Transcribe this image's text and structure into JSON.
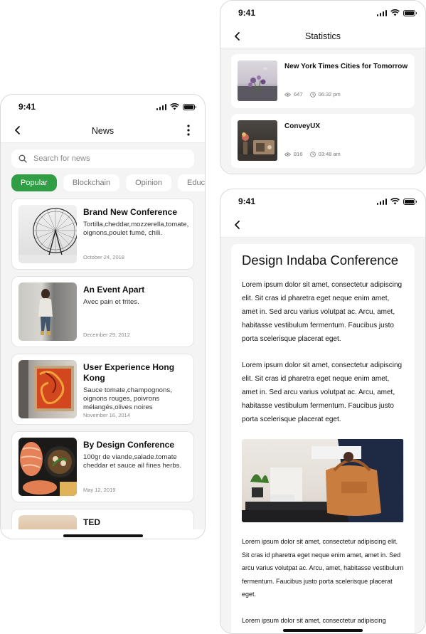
{
  "news_screen": {
    "time": "9:41",
    "title": "News",
    "search": {
      "placeholder": "Search for news"
    },
    "chips": [
      {
        "label": "Popular"
      },
      {
        "label": "Blockchain"
      },
      {
        "label": "Opinion"
      },
      {
        "label": "Educ"
      }
    ],
    "articles": [
      {
        "title": "Brand New Conference",
        "desc": "Tortilla,cheddar,mozzerella,tomate, oignons,poulet fumé, chili.",
        "date": "October 24, 2018"
      },
      {
        "title": "An Event Apart",
        "desc": "Avec pain et frites.",
        "date": "December 29, 2012"
      },
      {
        "title": "User Experience Hong Kong",
        "desc": "Sauce tomate,champognons, oignons rouges, poivrons mélangés,olives noires",
        "date": "November 16, 2014"
      },
      {
        "title": "By Design Conference",
        "desc": "100gr de viande,salade.tomate cheddar et sauce ail fines herbs.",
        "date": "May 12, 2019"
      },
      {
        "title": "TED",
        "desc": "",
        "date": ""
      }
    ]
  },
  "stats_screen": {
    "time": "9:41",
    "title": "Statistics",
    "items": [
      {
        "title": "New York Times Cities for Tomorrow",
        "views": "647",
        "time": "06:32 pm"
      },
      {
        "title": "ConveyUX",
        "views": "816",
        "time": "03:48 am"
      }
    ]
  },
  "article_screen": {
    "time": "9:41",
    "heading": "Design Indaba Conference",
    "paragraphs": [
      "Lorem ipsum dolor sit amet, consectetur adipiscing elit. Sit cras id pharetra eget neque enim amet, amet in. Sed arcu varius volutpat ac. Arcu, amet, habitasse vestibulum fermentum. Faucibus justo porta scelerisque placerat eget.",
      "Lorem ipsum dolor sit amet, consectetur adipiscing elit. Sit cras id pharetra eget neque enim amet, amet in. Sed arcu varius volutpat ac. Arcu, amet, habitasse vestibulum fermentum. Faucibus justo porta scelerisque placerat eget.",
      "Lorem ipsum dolor sit amet, consectetur adipiscing elit. Sit cras id pharetra eget neque enim amet, amet in. Sed arcu varius volutpat ac. Arcu, amet, habitasse vestibulum fermentum. Faucibus justo porta scelerisque placerat eget.",
      "Lorem ipsum dolor sit amet, consectetur adipiscing"
    ]
  },
  "colors": {
    "accent": "#2f9e44",
    "background": "#f4f4f4",
    "card": "#ffffff"
  }
}
